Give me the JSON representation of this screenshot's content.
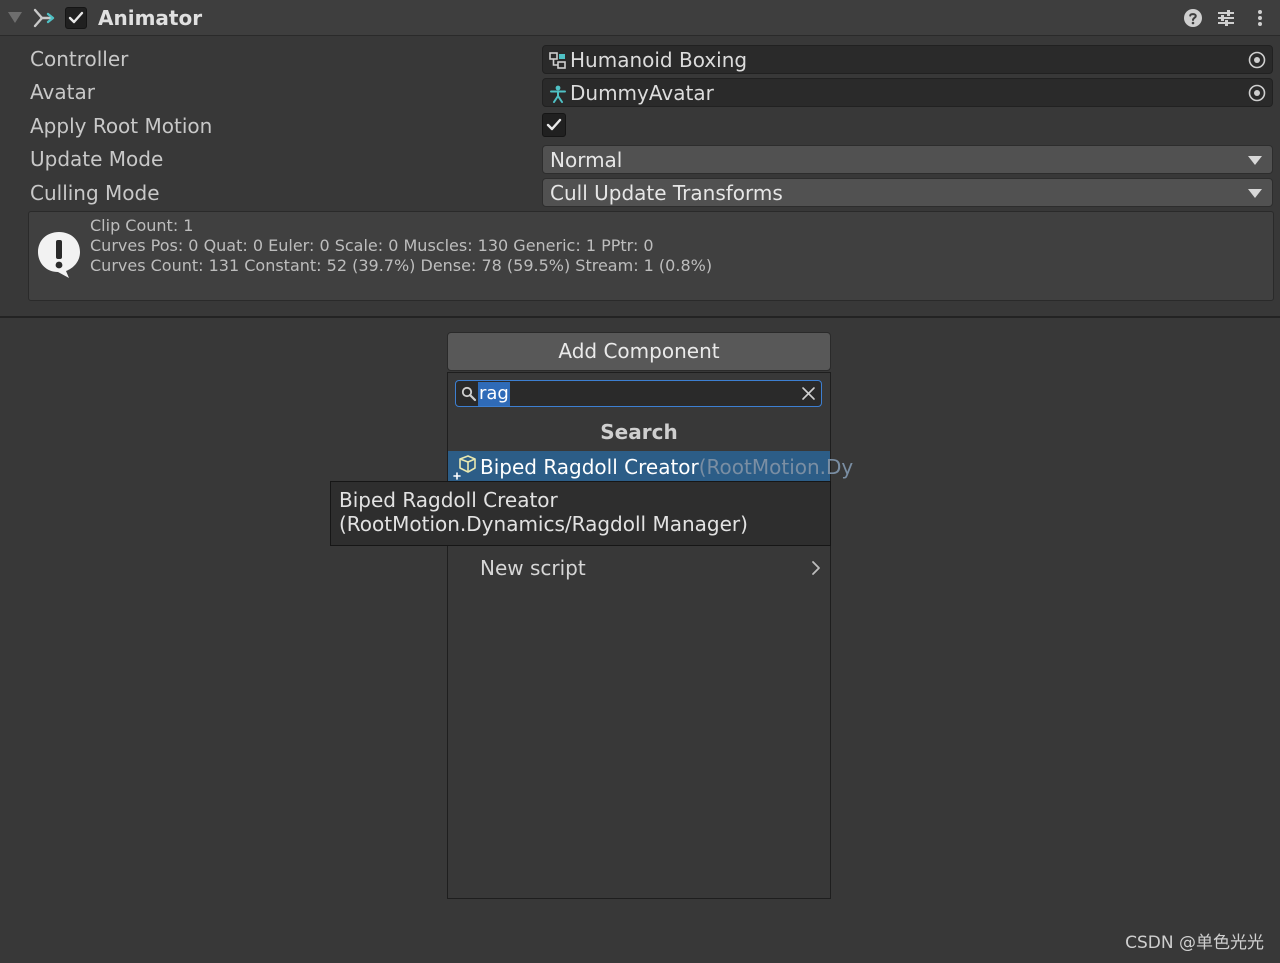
{
  "component": {
    "title": "Animator",
    "enabled": true,
    "icons": [
      "fold-arrow-icon",
      "animator-icon",
      "help-icon",
      "preset-icon",
      "kebab-menu-icon"
    ]
  },
  "properties": {
    "controller": {
      "label": "Controller",
      "value": "Humanoid Boxing",
      "icon": "animator-controller-icon"
    },
    "avatar": {
      "label": "Avatar",
      "value": "DummyAvatar",
      "icon": "avatar-icon"
    },
    "apply_root_motion": {
      "label": "Apply Root Motion",
      "checked": true
    },
    "update_mode": {
      "label": "Update Mode",
      "value": "Normal"
    },
    "culling_mode": {
      "label": "Culling Mode",
      "value": "Cull Update Transforms"
    }
  },
  "info": {
    "icon": "info-icon",
    "lines": [
      "Clip Count: 1",
      "Curves Pos: 0 Quat: 0 Euler: 0 Scale: 0 Muscles: 130 Generic: 1 PPtr: 0",
      "Curves Count: 131 Constant: 52 (39.7%) Dense: 78 (59.5%) Stream: 1 (0.8%)"
    ]
  },
  "add_component": {
    "button_label": "Add Component",
    "search_value": "rag",
    "section_title": "Search",
    "result": {
      "name": "Biped Ragdoll Creator",
      "path": "(RootMotion.Dy"
    },
    "new_script_label": "New script"
  },
  "tooltip": {
    "line1": "Biped Ragdoll Creator",
    "line2": "(RootMotion.Dynamics/Ragdoll Manager)"
  },
  "watermark": "CSDN @单色光光",
  "colors": {
    "background": "#383838",
    "selection": "#2c5d87",
    "search_focus": "#3d7fd1",
    "accent_teal": "#4fc1c5"
  }
}
